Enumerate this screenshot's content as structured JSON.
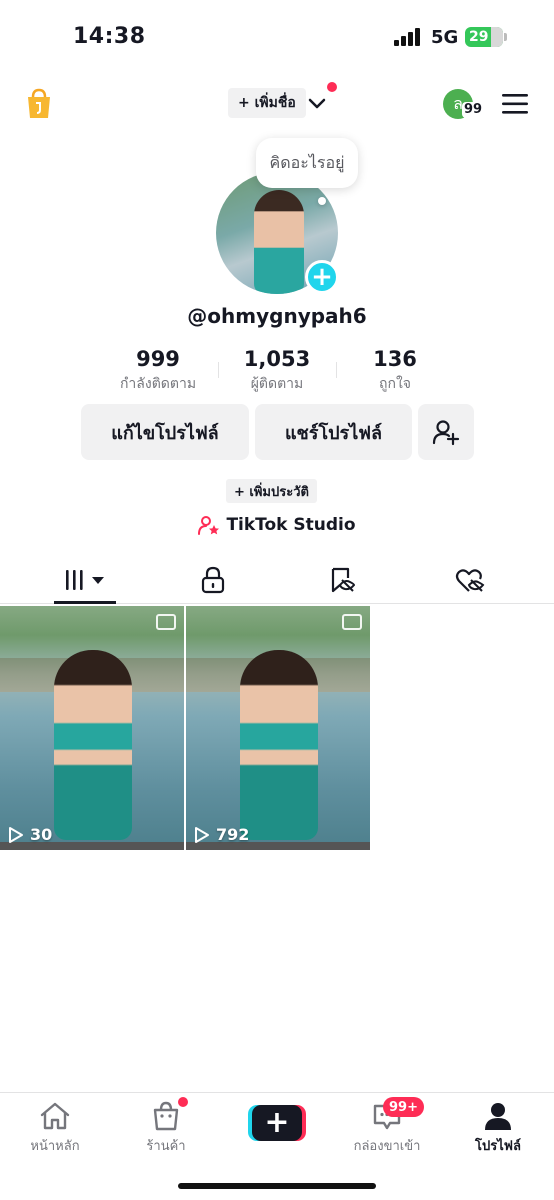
{
  "status_bar": {
    "time": "14:38",
    "network": "5G",
    "battery": "29"
  },
  "header": {
    "add_name_label": "+ เพิ่มชื่อ",
    "avatar_initial": "ล",
    "avatar_badge": "99"
  },
  "profile": {
    "thought_bubble": "คิดอะไรอยู่",
    "username": "@ohmygnypah6",
    "stats": [
      {
        "value": "999",
        "label": "กำลังติดตาม"
      },
      {
        "value": "1,053",
        "label": "ผู้ติดตาม"
      },
      {
        "value": "136",
        "label": "ถูกใจ"
      }
    ],
    "edit_profile_label": "แก้ไขโปรไฟล์",
    "share_profile_label": "แชร์โปรไฟล์",
    "add_bio_label": "+ เพิ่มประวัติ",
    "studio_label": "TikTok Studio"
  },
  "videos": [
    {
      "plays": "30"
    },
    {
      "plays": "792"
    }
  ],
  "bottom_nav": {
    "home": "หน้าหลัก",
    "shop": "ร้านค้า",
    "inbox": "กล่องขาเข้า",
    "inbox_badge": "99+",
    "profile": "โปรไฟล์"
  },
  "colors": {
    "accent_red": "#fe2c55",
    "accent_cyan": "#20d5ec",
    "text_primary": "#161823",
    "text_secondary": "#75767c"
  }
}
